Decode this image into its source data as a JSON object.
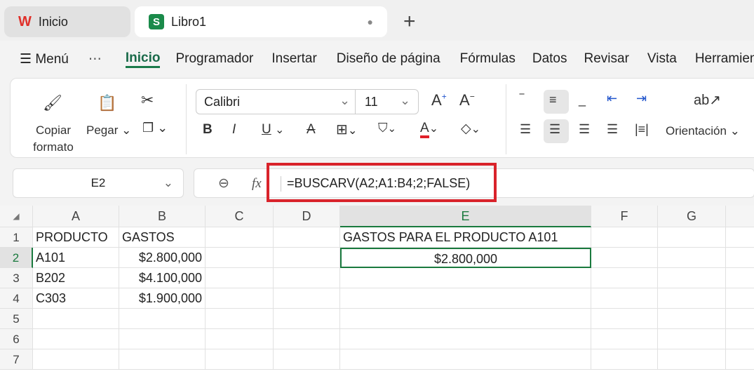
{
  "tabs": [
    {
      "label": "Inicio",
      "icon": "wps-logo-icon"
    },
    {
      "label": "Libro1",
      "icon": "spreadsheet-icon"
    }
  ],
  "menu": {
    "menu_label": "Menú",
    "more": "⋯",
    "items": [
      "Inicio",
      "Programador",
      "Insertar",
      "Diseño de página",
      "Fórmulas",
      "Datos",
      "Revisar",
      "Vista",
      "Herramientas"
    ],
    "active": "Inicio"
  },
  "ribbon": {
    "copy_format": "Copiar formato",
    "paste": "Pegar",
    "font": "Calibri",
    "size": "11",
    "orientation": "Orientación",
    "font_color": "#e0202a"
  },
  "formula_bar": {
    "name_box": "E2",
    "fx": "fx",
    "formula": "=BUSCARV(A2;A1:B4;2;FALSE)"
  },
  "sheet": {
    "columns": [
      "A",
      "B",
      "C",
      "D",
      "E",
      "F",
      "G"
    ],
    "rows": [
      "1",
      "2",
      "3",
      "4",
      "5",
      "6",
      "7"
    ],
    "cells": {
      "A1": "PRODUCTO",
      "B1": "GASTOS",
      "A2": "A101",
      "B2": "$2.800,000",
      "A3": "B202",
      "B3": "$4.100,000",
      "A4": "C303",
      "B4": "$1.900,000",
      "E1": "GASTOS PARA EL PRODUCTO A101",
      "E2": "$2.800,000"
    }
  }
}
